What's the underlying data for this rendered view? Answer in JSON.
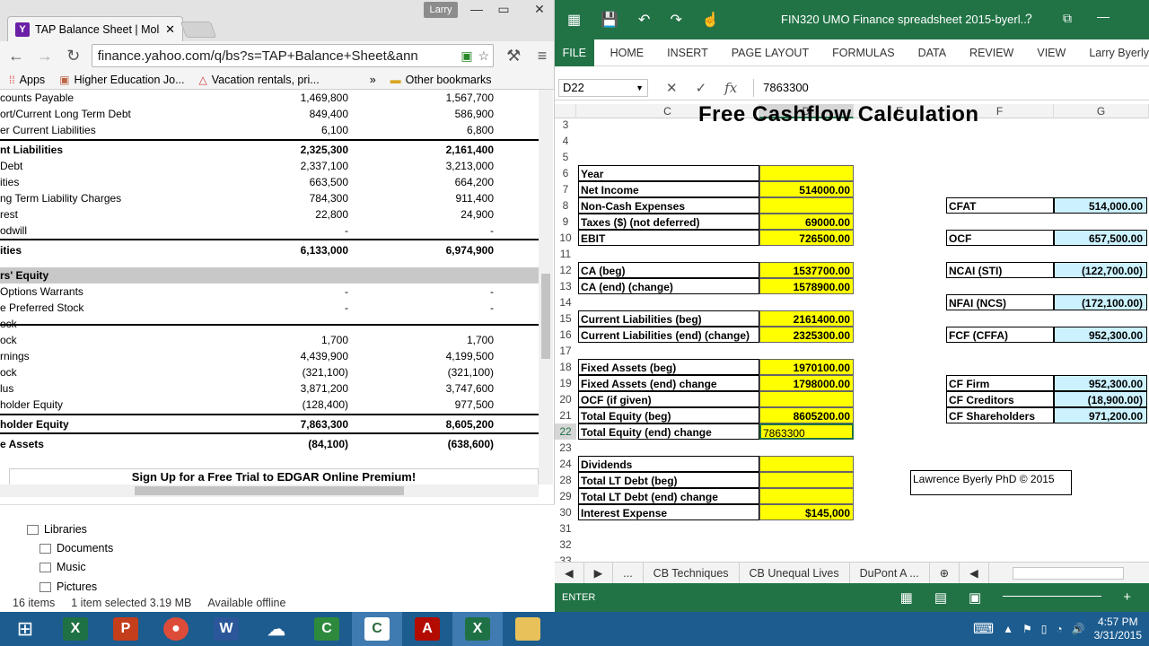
{
  "browser": {
    "tab_title": "TAP Balance Sheet | Molsc",
    "favicon": "Y",
    "user": "Larry",
    "url": "finance.yahoo.com/q/bs?s=TAP+Balance+Sheet&ann",
    "bookmarks": [
      "Apps",
      "Higher Education Jo...",
      "Vacation rentals, pri...",
      "Other bookmarks"
    ],
    "edgar_banner": "Sign Up for a Free Trial to EDGAR Online Premium!"
  },
  "balance_sheet": [
    {
      "label": "counts Payable",
      "v1": "1,469,800",
      "v2": "1,567,700"
    },
    {
      "label": "ort/Current Long Term Debt",
      "v1": "849,400",
      "v2": "586,900"
    },
    {
      "label": "er Current Liabilities",
      "v1": "6,100",
      "v2": "6,800"
    },
    {
      "label": "nt Liabilities",
      "v1": "2,325,300",
      "v2": "2,161,400",
      "bold": true
    },
    {
      "label": "Debt",
      "v1": "2,337,100",
      "v2": "3,213,000"
    },
    {
      "label": "ities",
      "v1": "663,500",
      "v2": "664,200"
    },
    {
      "label": "ng Term Liability Charges",
      "v1": "784,300",
      "v2": "911,400"
    },
    {
      "label": "rest",
      "v1": "22,800",
      "v2": "24,900"
    },
    {
      "label": "odwill",
      "v1": "-",
      "v2": "-"
    },
    {
      "label": "ities",
      "v1": "6,133,000",
      "v2": "6,974,900",
      "bold": true
    },
    {
      "label": "rs' Equity",
      "v1": "",
      "v2": "",
      "section": true
    },
    {
      "label": "Options Warrants",
      "v1": "-",
      "v2": "-"
    },
    {
      "label": "e Preferred Stock",
      "v1": "-",
      "v2": "-"
    },
    {
      "label": "ock",
      "v1": "-",
      "v2": "-"
    },
    {
      "label": "ock",
      "v1": "1,700",
      "v2": "1,700"
    },
    {
      "label": "rnings",
      "v1": "4,439,900",
      "v2": "4,199,500"
    },
    {
      "label": "ock",
      "v1": "(321,100)",
      "v2": "(321,100)"
    },
    {
      "label": "lus",
      "v1": "3,871,200",
      "v2": "3,747,600"
    },
    {
      "label": "holder Equity",
      "v1": "(128,400)",
      "v2": "977,500"
    },
    {
      "label": "holder Equity",
      "v1": "7,863,300",
      "v2": "8,605,200",
      "bold": true
    },
    {
      "label": "e Assets",
      "v1": "(84,100)",
      "v2": "(638,600)",
      "bold": true
    }
  ],
  "explorer": {
    "tree": [
      "Libraries",
      "Documents",
      "Music",
      "Pictures"
    ],
    "status": [
      "16 items",
      "1 item selected  3.19 MB",
      "Available offline"
    ]
  },
  "excel": {
    "title": "FIN320 UMO Finance spreadsheet 2015-byerl...",
    "file_tab": "FILE",
    "ribbon_tabs": [
      "HOME",
      "INSERT",
      "PAGE LAYOUT",
      "FORMULAS",
      "DATA",
      "REVIEW",
      "VIEW",
      "Larry Byerly"
    ],
    "name_box": "D22",
    "formula_value": "7863300",
    "fx": "fx",
    "columns": [
      "C",
      "D",
      "E",
      "F",
      "G"
    ],
    "big_title": "Free Cashflow Calculation",
    "row_numbers": [
      "3",
      "4",
      "5",
      "6",
      "7",
      "8",
      "9",
      "10",
      "11",
      "12",
      "13",
      "14",
      "15",
      "16",
      "17",
      "18",
      "19",
      "20",
      "21",
      "22",
      "23",
      "24",
      "28",
      "29",
      "30",
      "31",
      "32",
      "33"
    ],
    "left_rows": [
      {
        "row": "6",
        "label": "Year",
        "value": ""
      },
      {
        "row": "7",
        "label": "Net Income",
        "value": "514000.00"
      },
      {
        "row": "8",
        "label": "Non-Cash Expenses",
        "value": ""
      },
      {
        "row": "9",
        "label": "Taxes ($) (not deferred)",
        "value": "69000.00"
      },
      {
        "row": "10",
        "label": "EBIT",
        "value": "726500.00"
      },
      {
        "row": "12",
        "label": "CA (beg)",
        "value": "1537700.00"
      },
      {
        "row": "13",
        "label": "CA (end) (change)",
        "value": "1578900.00"
      },
      {
        "row": "15",
        "label": "Current Liabilities (beg)",
        "value": "2161400.00"
      },
      {
        "row": "16",
        "label": "Current Liabilities (end) (change)",
        "value": "2325300.00"
      },
      {
        "row": "18",
        "label": "Fixed Assets (beg)",
        "value": "1970100.00"
      },
      {
        "row": "19",
        "label": "Fixed Assets (end) change",
        "value": "1798000.00"
      },
      {
        "row": "20",
        "label": "OCF (if given)",
        "value": ""
      },
      {
        "row": "21",
        "label": "Total Equity (beg)",
        "value": "8605200.00"
      },
      {
        "row": "22",
        "label": "Total Equity (end) change",
        "value": "7863300"
      },
      {
        "row": "24",
        "label": "Dividends",
        "value": ""
      },
      {
        "row": "28",
        "label": "Total LT Debt (beg)",
        "value": ""
      },
      {
        "row": "29",
        "label": "Total LT Debt (end) change",
        "value": ""
      },
      {
        "row": "30",
        "label": "Interest Expense",
        "value": "$145,000"
      }
    ],
    "right_rows": [
      {
        "row": "8",
        "label": "CFAT",
        "value": "514,000.00"
      },
      {
        "row": "10",
        "label": "OCF",
        "value": "657,500.00"
      },
      {
        "row": "12",
        "label": "NCAI (STI)",
        "value": "(122,700.00)"
      },
      {
        "row": "14",
        "label": "NFAI (NCS)",
        "value": "(172,100.00)"
      },
      {
        "row": "16",
        "label": "FCF (CFFA)",
        "value": "952,300.00"
      },
      {
        "row": "19",
        "label": "CF Firm",
        "value": "952,300.00"
      },
      {
        "row": "20",
        "label": "CF Creditors",
        "value": "(18,900.00)"
      },
      {
        "row": "21",
        "label": "CF Shareholders",
        "value": "971,200.00"
      }
    ],
    "copyright": "Lawrence Byerly PhD © 2015",
    "sheet_tabs": [
      "...",
      "CB Techniques",
      "CB Unequal Lives",
      "DuPont A ..."
    ],
    "status": "ENTER"
  },
  "taskbar": {
    "apps": [
      "Excel",
      "PowerPoint",
      "Chrome",
      "Word",
      "OneDrive",
      "Camtasia",
      "Camtasia Recorder",
      "Acrobat",
      "Excel",
      "File Explorer"
    ],
    "time": "4:57 PM",
    "date": "3/31/2015"
  },
  "colors": {
    "excel_green": "#217346",
    "cell_yellow": "#ffff00",
    "cell_blue": "#ccf2ff",
    "taskbar": "#1c5c8f"
  }
}
